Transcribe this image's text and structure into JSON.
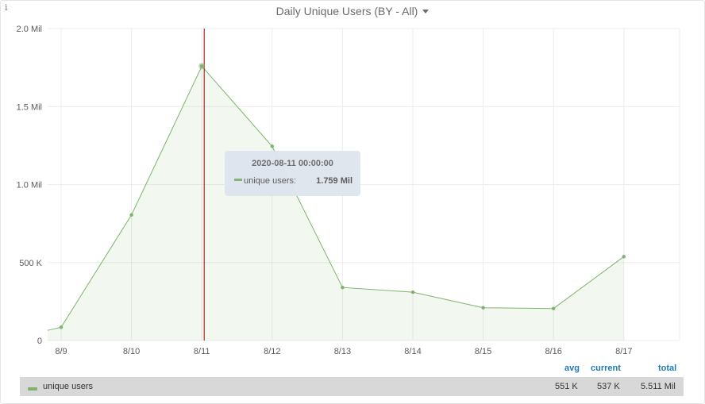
{
  "panel": {
    "title": "Daily Unique Users (BY - All)",
    "info_icon": "i"
  },
  "chart_data": {
    "type": "area",
    "x": [
      "8/9",
      "8/10",
      "8/11",
      "8/12",
      "8/13",
      "8/14",
      "8/15",
      "8/16",
      "8/17"
    ],
    "series": [
      {
        "name": "unique users",
        "color": "#7eb26d",
        "values": [
          85000,
          805000,
          1759000,
          1245000,
          340000,
          310000,
          210000,
          205000,
          538000
        ],
        "leading_value": 65000
      }
    ],
    "ylim": [
      0,
      2000000
    ],
    "y_ticks": [
      "0",
      "500 K",
      "1.0 Mil",
      "1.5 Mil",
      "2.0 Mil"
    ],
    "y_tick_values": [
      0,
      500000,
      1000000,
      1500000,
      2000000
    ],
    "grid": true,
    "cursor_x": "8/11"
  },
  "tooltip": {
    "time": "2020-08-11 00:00:00",
    "series_label": "unique users:",
    "value": "1.759 Mil"
  },
  "legend": {
    "headers": {
      "avg": "avg",
      "current": "current",
      "total": "total"
    },
    "rows": [
      {
        "name": "unique users",
        "avg": "551 K",
        "current": "537 K",
        "total": "5.511 Mil"
      }
    ]
  }
}
